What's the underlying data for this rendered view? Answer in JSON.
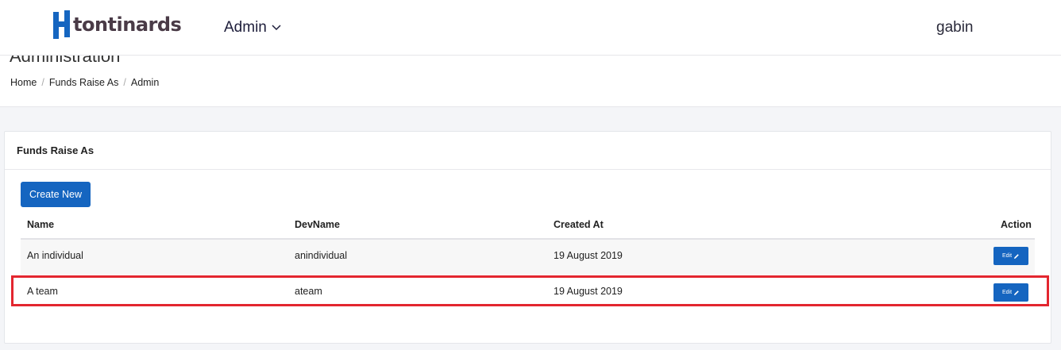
{
  "brand": {
    "name": "tontinards",
    "mark_color": "#1565c0",
    "text_color": "#4a3b47"
  },
  "nav": {
    "admin_label": "Admin",
    "dropdown_icon": "chevron-down-icon"
  },
  "user": {
    "name": "gabin"
  },
  "page": {
    "title": "Administration",
    "breadcrumb": [
      "Home",
      "Funds Raise As",
      "Admin"
    ]
  },
  "card": {
    "title": "Funds Raise As",
    "create_label": "Create New",
    "columns": [
      "Name",
      "DevName",
      "Created At",
      "Action"
    ],
    "rows": [
      {
        "name": "An individual",
        "devname": "anindividual",
        "created_at": "19 August 2019",
        "action_label": "Edit"
      },
      {
        "name": "A team",
        "devname": "ateam",
        "created_at": "19 August 2019",
        "action_label": "Edit"
      }
    ]
  },
  "colors": {
    "primary": "#1565c0",
    "highlight": "#e3262f"
  }
}
